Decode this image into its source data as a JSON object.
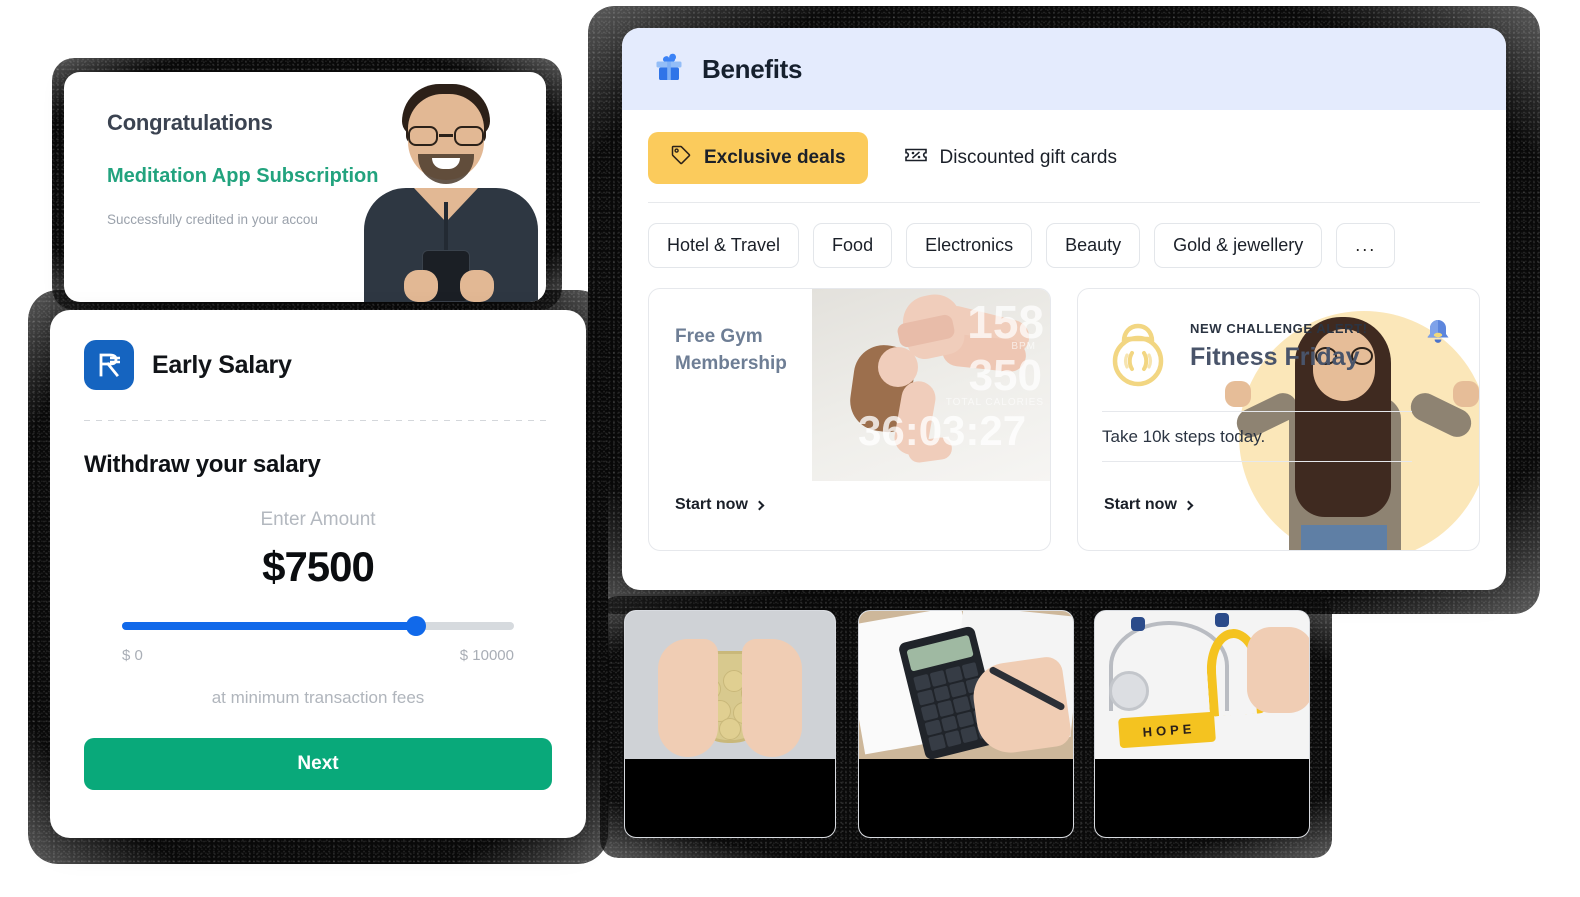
{
  "congrats": {
    "title": "Congratulations",
    "subtitle": "Meditation App Subscription",
    "note": "Successfully credited in your accou",
    "photo_icon": "man-with-phone-photo"
  },
  "salary": {
    "brand_name": "Early Salary",
    "brand_logo_icon": "rupee-logo-icon",
    "withdraw_title": "Withdraw your salary",
    "amount_label": "Enter Amount",
    "amount_value": "$7500",
    "slider": {
      "min_label": "$ 0",
      "max_label": "$ 10000",
      "min": 0,
      "max": 10000,
      "value": 7500,
      "fill_color": "#1169ea",
      "track_color": "#d6dade"
    },
    "fees_note": "at minimum transaction fees",
    "next_label": "Next",
    "next_color": "#09a97a"
  },
  "benefits": {
    "title": "Benefits",
    "header_icon": "gift-box-icon",
    "header_bg": "#e4ebfd",
    "tabs": [
      {
        "label": "Exclusive deals",
        "icon": "price-tag-icon",
        "active": true,
        "active_color": "#fbcb5c"
      },
      {
        "label": "Discounted gift cards",
        "icon": "discount-ticket-icon",
        "active": false
      }
    ],
    "chips": [
      "Hotel & Travel",
      "Food",
      "Electronics",
      "Beauty",
      "Gold & jewellery",
      "..."
    ],
    "deals": [
      {
        "title": "Free Gym Membership",
        "link": "Start now",
        "photo_icon": "yoga-woman-photo",
        "overlay": {
          "bpm_value": "158",
          "bpm_label": "BPM",
          "calories_value": "350",
          "calories_label": "TOTAL CALORIES",
          "timer": "36:03:27"
        }
      },
      {
        "alert": "NEW CHALLENGE ALERT!",
        "title": "Fitness Friday",
        "subtitle": "Take 10k steps today.",
        "link": "Start now",
        "kettlebell_icon": "kettlebell-icon",
        "bell_icon": "bell-icon",
        "photo_icon": "flexing-woman-photo"
      }
    ]
  },
  "bottom_cards": [
    {
      "photo_icon": "hands-holding-coin-jar-photo"
    },
    {
      "photo_icon": "hands-using-calculator-photo"
    },
    {
      "photo_icon": "stethoscope-hope-ribbon-photo"
    }
  ]
}
